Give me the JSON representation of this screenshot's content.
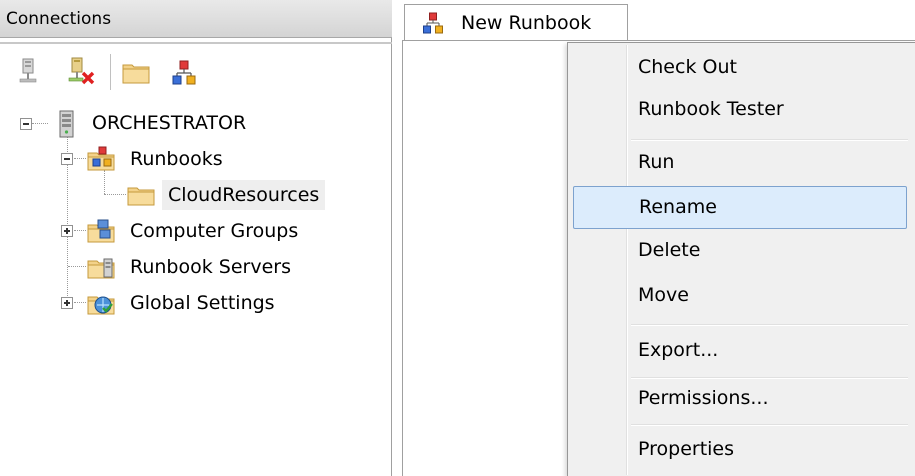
{
  "connections_pane": {
    "title": "Connections",
    "toolbar": {
      "icons": [
        "connect-icon",
        "disconnect-icon",
        "new-folder-icon",
        "new-runbook-icon"
      ]
    },
    "tree": {
      "root": {
        "label": "ORCHESTRATOR",
        "icon": "server-icon",
        "expanded": true
      },
      "runbooks": {
        "label": "Runbooks",
        "icon": "runbooks-folder-icon",
        "expanded": true
      },
      "cloudresources": {
        "label": "CloudResources",
        "icon": "folder-icon",
        "selected": true
      },
      "computer_groups": {
        "label": "Computer Groups",
        "icon": "computer-groups-folder-icon",
        "expanded": false
      },
      "runbook_servers": {
        "label": "Runbook Servers",
        "icon": "runbook-servers-folder-icon"
      },
      "global_settings": {
        "label": "Global Settings",
        "icon": "global-settings-folder-icon",
        "expanded": false
      }
    }
  },
  "document_tab": {
    "label": "New Runbook",
    "icon": "runbook-icon"
  },
  "context_menu": {
    "items": [
      {
        "label": "Check Out"
      },
      {
        "label": "Runbook Tester"
      },
      {
        "label": "Run"
      },
      {
        "label": "Rename",
        "highlighted": true
      },
      {
        "label": "Delete"
      },
      {
        "label": "Move"
      },
      {
        "label": "Export..."
      },
      {
        "label": "Permissions..."
      },
      {
        "label": "Properties"
      }
    ]
  },
  "colors": {
    "menu_highlight": "#dcecfc",
    "menu_highlight_border": "#7da2ce",
    "menu_background": "#f0f0f0",
    "pane_header": "#d4d4d4"
  }
}
